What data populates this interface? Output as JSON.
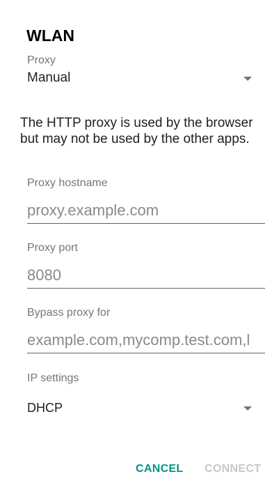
{
  "dialog": {
    "title": "WLAN",
    "proxy": {
      "label": "Proxy",
      "selected": "Manual"
    },
    "note": "The HTTP proxy is used by the browser but may not be used by the other apps.",
    "hostname": {
      "label": "Proxy hostname",
      "placeholder": "proxy.example.com"
    },
    "port": {
      "label": "Proxy port",
      "placeholder": "8080"
    },
    "bypass": {
      "label": "Bypass proxy for",
      "placeholder": "example.com,mycomp.test.com,l"
    },
    "ip_settings": {
      "label": "IP settings",
      "selected": "DHCP"
    },
    "buttons": {
      "cancel": "CANCEL",
      "connect": "CONNECT"
    }
  },
  "colors": {
    "accent": "#009688",
    "disabled": "#c7c7c7",
    "hint": "#8a8a8a",
    "label": "#757575"
  },
  "icons": {
    "proxy_dropdown": "dropdown-arrow-icon",
    "ip_dropdown": "dropdown-arrow-icon"
  }
}
